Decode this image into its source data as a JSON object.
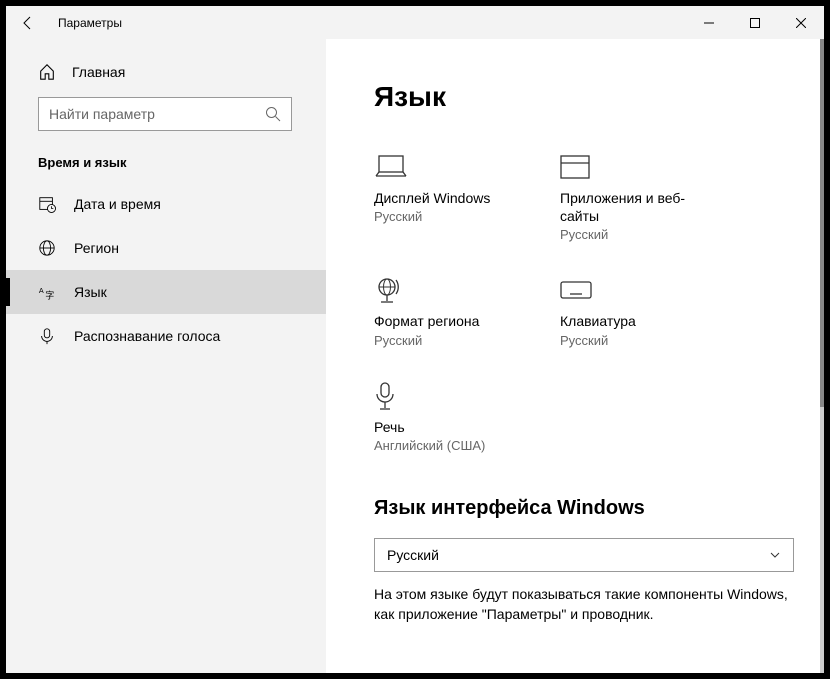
{
  "titlebar": {
    "title": "Параметры"
  },
  "sidebar": {
    "home": "Главная",
    "search_placeholder": "Найти параметр",
    "section": "Время и язык",
    "items": [
      {
        "label": "Дата и время"
      },
      {
        "label": "Регион"
      },
      {
        "label": "Язык"
      },
      {
        "label": "Распознавание голоса"
      }
    ]
  },
  "main": {
    "title": "Язык",
    "tiles": [
      {
        "label": "Дисплей Windows",
        "value": "Русский"
      },
      {
        "label": "Приложения и веб-сайты",
        "value": "Русский"
      },
      {
        "label": "Формат региона",
        "value": "Русский"
      },
      {
        "label": "Клавиатура",
        "value": "Русский"
      },
      {
        "label": "Речь",
        "value": "Английский (США)"
      }
    ],
    "display_lang": {
      "title": "Язык интерфейса Windows",
      "value": "Русский",
      "desc": "На этом языке будут показываться такие компоненты Windows, как приложение \"Параметры\" и проводник."
    }
  }
}
